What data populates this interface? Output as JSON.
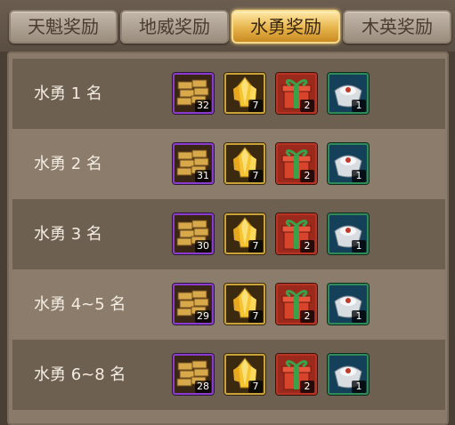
{
  "tabs": [
    {
      "label": "天魁奖励",
      "active": false
    },
    {
      "label": "地威奖励",
      "active": false
    },
    {
      "label": "水勇奖励",
      "active": true
    },
    {
      "label": "木英奖励",
      "active": false
    }
  ],
  "rewards": [
    {
      "rank": "水勇 1 名",
      "items": [
        {
          "icon": "gold-brick-stack-icon",
          "count": "32"
        },
        {
          "icon": "gold-crystal-icon",
          "count": "7"
        },
        {
          "icon": "gift-box-icon",
          "count": "2"
        },
        {
          "icon": "silver-ingot-icon",
          "count": "1"
        }
      ]
    },
    {
      "rank": "水勇 2 名",
      "items": [
        {
          "icon": "gold-brick-stack-icon",
          "count": "31"
        },
        {
          "icon": "gold-crystal-icon",
          "count": "7"
        },
        {
          "icon": "gift-box-icon",
          "count": "2"
        },
        {
          "icon": "silver-ingot-icon",
          "count": "1"
        }
      ]
    },
    {
      "rank": "水勇 3 名",
      "items": [
        {
          "icon": "gold-brick-stack-icon",
          "count": "30"
        },
        {
          "icon": "gold-crystal-icon",
          "count": "7"
        },
        {
          "icon": "gift-box-icon",
          "count": "2"
        },
        {
          "icon": "silver-ingot-icon",
          "count": "1"
        }
      ]
    },
    {
      "rank": "水勇 4~5 名",
      "items": [
        {
          "icon": "gold-brick-stack-icon",
          "count": "29"
        },
        {
          "icon": "gold-crystal-icon",
          "count": "7"
        },
        {
          "icon": "gift-box-icon",
          "count": "2"
        },
        {
          "icon": "silver-ingot-icon",
          "count": "1"
        }
      ]
    },
    {
      "rank": "水勇 6~8 名",
      "items": [
        {
          "icon": "gold-brick-stack-icon",
          "count": "28"
        },
        {
          "icon": "gold-crystal-icon",
          "count": "7"
        },
        {
          "icon": "gift-box-icon",
          "count": "2"
        },
        {
          "icon": "silver-ingot-icon",
          "count": "1"
        }
      ]
    }
  ]
}
